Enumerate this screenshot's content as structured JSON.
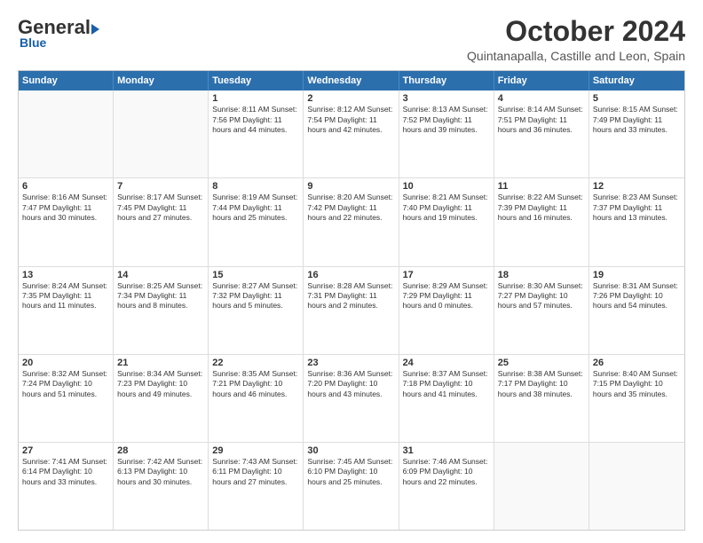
{
  "header": {
    "logo_general": "General",
    "logo_blue": "Blue",
    "month_title": "October 2024",
    "location": "Quintanapalla, Castille and Leon, Spain"
  },
  "weekdays": [
    "Sunday",
    "Monday",
    "Tuesday",
    "Wednesday",
    "Thursday",
    "Friday",
    "Saturday"
  ],
  "rows": [
    [
      {
        "day": "",
        "info": "",
        "empty": true
      },
      {
        "day": "",
        "info": "",
        "empty": true
      },
      {
        "day": "1",
        "info": "Sunrise: 8:11 AM\nSunset: 7:56 PM\nDaylight: 11 hours\nand 44 minutes."
      },
      {
        "day": "2",
        "info": "Sunrise: 8:12 AM\nSunset: 7:54 PM\nDaylight: 11 hours\nand 42 minutes."
      },
      {
        "day": "3",
        "info": "Sunrise: 8:13 AM\nSunset: 7:52 PM\nDaylight: 11 hours\nand 39 minutes."
      },
      {
        "day": "4",
        "info": "Sunrise: 8:14 AM\nSunset: 7:51 PM\nDaylight: 11 hours\nand 36 minutes."
      },
      {
        "day": "5",
        "info": "Sunrise: 8:15 AM\nSunset: 7:49 PM\nDaylight: 11 hours\nand 33 minutes."
      }
    ],
    [
      {
        "day": "6",
        "info": "Sunrise: 8:16 AM\nSunset: 7:47 PM\nDaylight: 11 hours\nand 30 minutes."
      },
      {
        "day": "7",
        "info": "Sunrise: 8:17 AM\nSunset: 7:45 PM\nDaylight: 11 hours\nand 27 minutes."
      },
      {
        "day": "8",
        "info": "Sunrise: 8:19 AM\nSunset: 7:44 PM\nDaylight: 11 hours\nand 25 minutes."
      },
      {
        "day": "9",
        "info": "Sunrise: 8:20 AM\nSunset: 7:42 PM\nDaylight: 11 hours\nand 22 minutes."
      },
      {
        "day": "10",
        "info": "Sunrise: 8:21 AM\nSunset: 7:40 PM\nDaylight: 11 hours\nand 19 minutes."
      },
      {
        "day": "11",
        "info": "Sunrise: 8:22 AM\nSunset: 7:39 PM\nDaylight: 11 hours\nand 16 minutes."
      },
      {
        "day": "12",
        "info": "Sunrise: 8:23 AM\nSunset: 7:37 PM\nDaylight: 11 hours\nand 13 minutes."
      }
    ],
    [
      {
        "day": "13",
        "info": "Sunrise: 8:24 AM\nSunset: 7:35 PM\nDaylight: 11 hours\nand 11 minutes."
      },
      {
        "day": "14",
        "info": "Sunrise: 8:25 AM\nSunset: 7:34 PM\nDaylight: 11 hours\nand 8 minutes."
      },
      {
        "day": "15",
        "info": "Sunrise: 8:27 AM\nSunset: 7:32 PM\nDaylight: 11 hours\nand 5 minutes."
      },
      {
        "day": "16",
        "info": "Sunrise: 8:28 AM\nSunset: 7:31 PM\nDaylight: 11 hours\nand 2 minutes."
      },
      {
        "day": "17",
        "info": "Sunrise: 8:29 AM\nSunset: 7:29 PM\nDaylight: 11 hours\nand 0 minutes."
      },
      {
        "day": "18",
        "info": "Sunrise: 8:30 AM\nSunset: 7:27 PM\nDaylight: 10 hours\nand 57 minutes."
      },
      {
        "day": "19",
        "info": "Sunrise: 8:31 AM\nSunset: 7:26 PM\nDaylight: 10 hours\nand 54 minutes."
      }
    ],
    [
      {
        "day": "20",
        "info": "Sunrise: 8:32 AM\nSunset: 7:24 PM\nDaylight: 10 hours\nand 51 minutes."
      },
      {
        "day": "21",
        "info": "Sunrise: 8:34 AM\nSunset: 7:23 PM\nDaylight: 10 hours\nand 49 minutes."
      },
      {
        "day": "22",
        "info": "Sunrise: 8:35 AM\nSunset: 7:21 PM\nDaylight: 10 hours\nand 46 minutes."
      },
      {
        "day": "23",
        "info": "Sunrise: 8:36 AM\nSunset: 7:20 PM\nDaylight: 10 hours\nand 43 minutes."
      },
      {
        "day": "24",
        "info": "Sunrise: 8:37 AM\nSunset: 7:18 PM\nDaylight: 10 hours\nand 41 minutes."
      },
      {
        "day": "25",
        "info": "Sunrise: 8:38 AM\nSunset: 7:17 PM\nDaylight: 10 hours\nand 38 minutes."
      },
      {
        "day": "26",
        "info": "Sunrise: 8:40 AM\nSunset: 7:15 PM\nDaylight: 10 hours\nand 35 minutes."
      }
    ],
    [
      {
        "day": "27",
        "info": "Sunrise: 7:41 AM\nSunset: 6:14 PM\nDaylight: 10 hours\nand 33 minutes."
      },
      {
        "day": "28",
        "info": "Sunrise: 7:42 AM\nSunset: 6:13 PM\nDaylight: 10 hours\nand 30 minutes."
      },
      {
        "day": "29",
        "info": "Sunrise: 7:43 AM\nSunset: 6:11 PM\nDaylight: 10 hours\nand 27 minutes."
      },
      {
        "day": "30",
        "info": "Sunrise: 7:45 AM\nSunset: 6:10 PM\nDaylight: 10 hours\nand 25 minutes."
      },
      {
        "day": "31",
        "info": "Sunrise: 7:46 AM\nSunset: 6:09 PM\nDaylight: 10 hours\nand 22 minutes."
      },
      {
        "day": "",
        "info": "",
        "empty": true
      },
      {
        "day": "",
        "info": "",
        "empty": true
      }
    ]
  ]
}
